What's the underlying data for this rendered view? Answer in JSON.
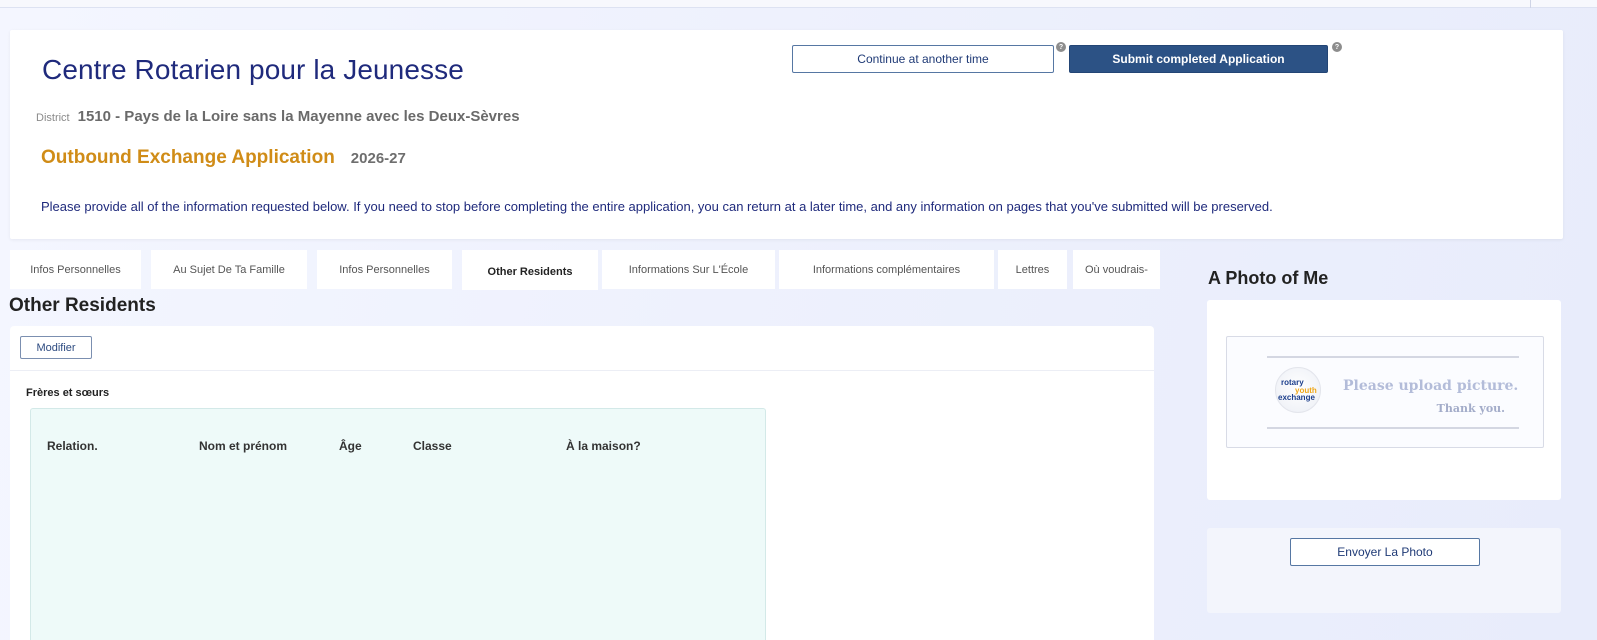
{
  "header": {
    "org_title": "Centre Rotarien pour la Jeunesse",
    "district_label": "District",
    "district_value": "1510 - Pays de la Loire sans la Mayenne avec les Deux-Sèvres",
    "app_title": "Outbound Exchange Application",
    "app_year": "2026-27",
    "info_text": "Please provide all of the information requested below. If you need to stop before completing the entire application, you can return at a later time, and any information on pages that you've submitted will be preserved.",
    "continue_label": "Continue at another time",
    "submit_label": "Submit completed Application",
    "help_glyph": "?"
  },
  "tabs": [
    {
      "label": "Infos Personnelles",
      "active": false
    },
    {
      "label": "Au Sujet De Ta Famille",
      "active": false
    },
    {
      "label": "Infos Personnelles",
      "active": false
    },
    {
      "label": "Other Residents",
      "active": true
    },
    {
      "label": "Informations Sur L'École",
      "active": false
    },
    {
      "label": "Informations complémentaires",
      "active": false
    },
    {
      "label": "Lettres",
      "active": false
    },
    {
      "label": "Où voudrais-",
      "active": false
    }
  ],
  "main": {
    "section_title": "Other Residents",
    "modifier_label": "Modifier",
    "siblings_label": "Frères et sœurs",
    "columns": [
      "Relation.",
      "Nom et prénom",
      "Âge",
      "Classe",
      "À la maison?"
    ]
  },
  "photo": {
    "title": "A Photo of Me",
    "placeholder_line1": "Please upload picture.",
    "placeholder_line2": "Thank you.",
    "logo_words": [
      "rotary",
      "youth",
      "exchange"
    ],
    "upload_label": "Envoyer La Photo"
  },
  "colors": {
    "brand_navy": "#1f2a7c",
    "accent_gold": "#d08c17",
    "submit_blue": "#2c5285",
    "table_bg": "#eefaf9"
  }
}
